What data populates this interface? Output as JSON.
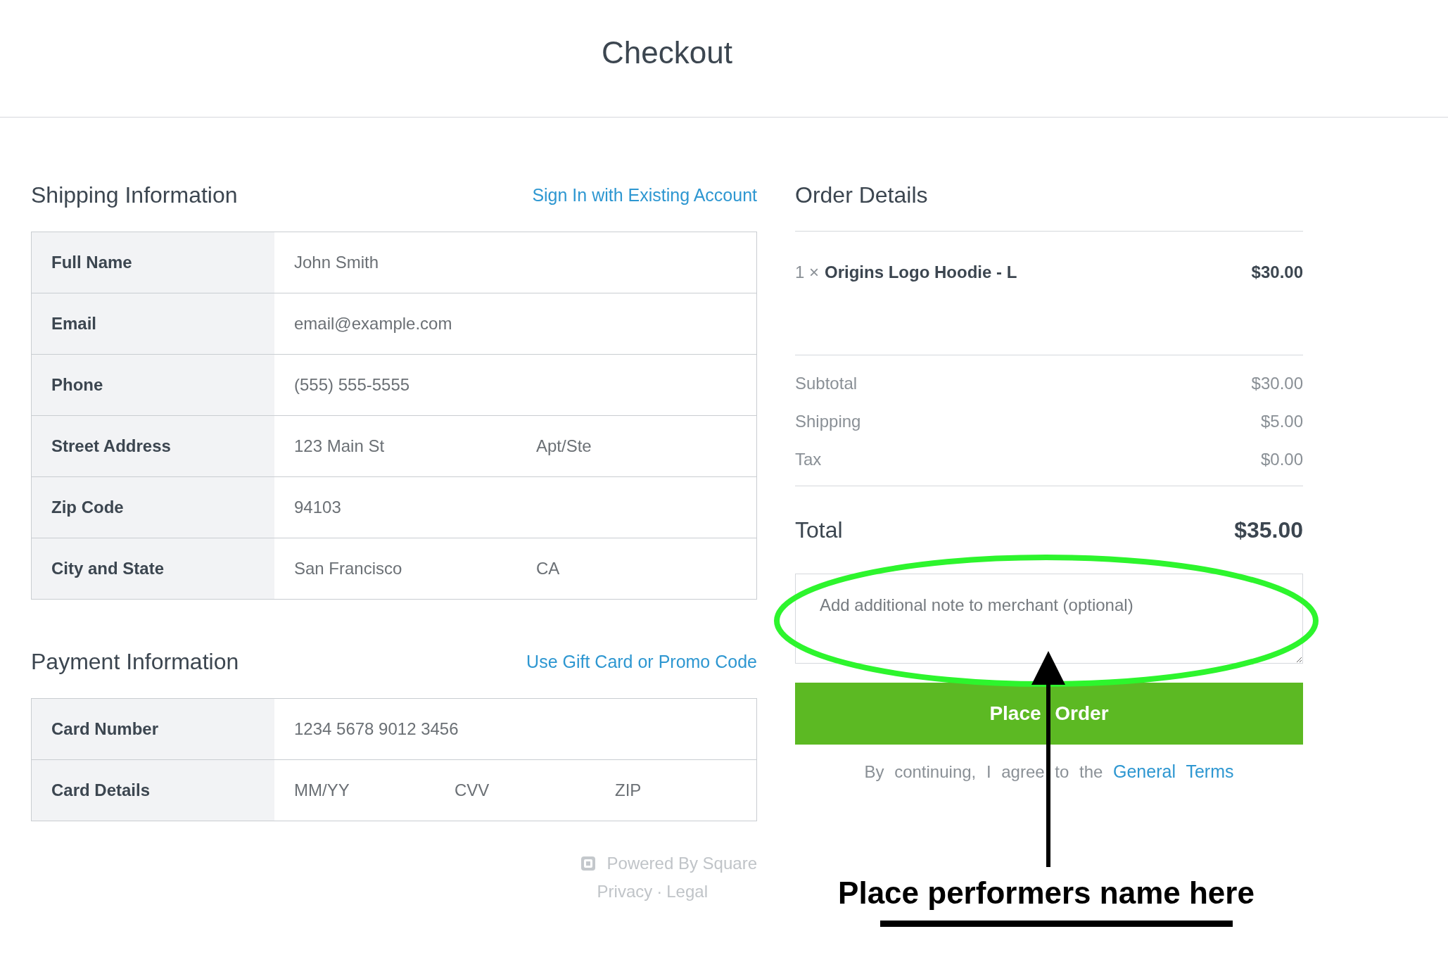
{
  "page_title": "Checkout",
  "shipping": {
    "heading": "Shipping Information",
    "link": "Sign In with Existing Account",
    "rows": [
      {
        "label": "Full Name",
        "inputs": [
          {
            "placeholder": "John Smith"
          }
        ]
      },
      {
        "label": "Email",
        "inputs": [
          {
            "placeholder": "email@example.com"
          }
        ]
      },
      {
        "label": "Phone",
        "inputs": [
          {
            "placeholder": "(555) 555-5555"
          }
        ]
      },
      {
        "label": "Street Address",
        "inputs": [
          {
            "placeholder": "123 Main St"
          },
          {
            "placeholder": "Apt/Ste"
          }
        ]
      },
      {
        "label": "Zip Code",
        "inputs": [
          {
            "placeholder": "94103"
          }
        ]
      },
      {
        "label": "City and State",
        "inputs": [
          {
            "placeholder": "San Francisco"
          },
          {
            "placeholder": "CA"
          }
        ]
      }
    ]
  },
  "payment": {
    "heading": "Payment Information",
    "link": "Use Gift Card or Promo Code",
    "rows": [
      {
        "label": "Card Number",
        "inputs": [
          {
            "placeholder": "1234 5678 9012 3456"
          }
        ]
      },
      {
        "label": "Card Details",
        "inputs": [
          {
            "placeholder": "MM/YY"
          },
          {
            "placeholder": "CVV"
          },
          {
            "placeholder": "ZIP"
          }
        ]
      }
    ]
  },
  "footer": {
    "powered": "Powered By Square",
    "links": [
      "Privacy",
      "Legal"
    ],
    "separator": "·"
  },
  "order": {
    "heading": "Order Details",
    "items": [
      {
        "quantity": "1 ×",
        "name": "Origins Logo Hoodie - L",
        "price": "$30.00"
      }
    ],
    "summary": [
      {
        "label": "Subtotal",
        "value": "$30.00"
      },
      {
        "label": "Shipping",
        "value": "$5.00"
      },
      {
        "label": "Tax",
        "value": "$0.00"
      }
    ],
    "total": {
      "label": "Total",
      "value": "$35.00"
    },
    "note_placeholder": "Add additional note to merchant (optional)",
    "button": "Place Order",
    "terms": {
      "text": "By continuing, I agree to the",
      "link": "General Terms"
    }
  },
  "annotation": {
    "text": "Place performers name here"
  }
}
